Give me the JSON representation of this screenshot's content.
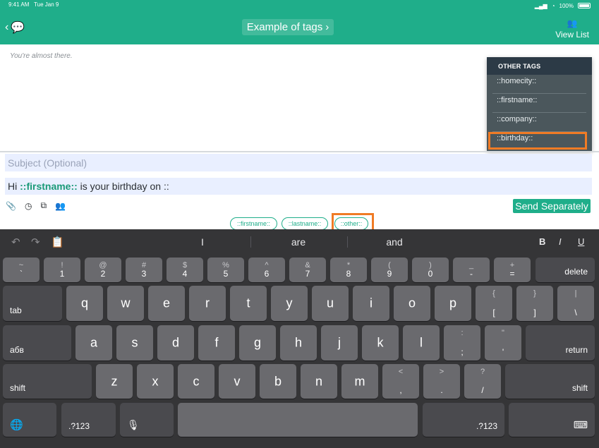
{
  "status": {
    "time": "9:41 AM",
    "date": "Tue Jan 9",
    "battery": "100%"
  },
  "nav": {
    "title": "Example of tags",
    "view_list": "View List"
  },
  "content": {
    "hint": "You're almost there."
  },
  "tags_panel": {
    "header": "OTHER TAGS",
    "items": [
      "::homecity::",
      "::firstname::",
      "::company::",
      "::birthday::"
    ]
  },
  "compose": {
    "subject_placeholder": "Subject (Optional)",
    "body_prefix": "Hi ",
    "body_tag": "::firstname::",
    "body_suffix": " is your birthday on ::",
    "send_label": "Send Separately"
  },
  "chips": [
    "::firstname::",
    "::lastname::",
    "::other::"
  ],
  "keyboard": {
    "suggestions": [
      "I",
      "are",
      "and"
    ],
    "format": [
      "B",
      "I",
      "U"
    ],
    "row1": [
      {
        "top": "~",
        "bot": "`"
      },
      {
        "top": "!",
        "bot": "1"
      },
      {
        "top": "@",
        "bot": "2"
      },
      {
        "top": "#",
        "bot": "3"
      },
      {
        "top": "$",
        "bot": "4"
      },
      {
        "top": "%",
        "bot": "5"
      },
      {
        "top": "^",
        "bot": "6"
      },
      {
        "top": "&",
        "bot": "7"
      },
      {
        "top": "*",
        "bot": "8"
      },
      {
        "top": "(",
        "bot": "9"
      },
      {
        "top": ")",
        "bot": "0"
      },
      {
        "top": "_",
        "bot": "-"
      },
      {
        "top": "+",
        "bot": "="
      }
    ],
    "delete": "delete",
    "tab": "tab",
    "row2": [
      "q",
      "w",
      "e",
      "r",
      "t",
      "y",
      "u",
      "i",
      "o",
      "p"
    ],
    "row2_extra": [
      {
        "top": "{",
        "bot": "["
      },
      {
        "top": "}",
        "bot": "]"
      },
      {
        "top": "|",
        "bot": "\\"
      }
    ],
    "caps": "абв",
    "row3": [
      "a",
      "s",
      "d",
      "f",
      "g",
      "h",
      "j",
      "k",
      "l"
    ],
    "row3_extra": [
      {
        "top": ":",
        "bot": ";"
      },
      {
        "top": "\"",
        "bot": "'"
      }
    ],
    "return": "return",
    "shift": "shift",
    "row4": [
      "z",
      "x",
      "c",
      "v",
      "b",
      "n",
      "m"
    ],
    "row4_extra": [
      {
        "top": "<",
        "bot": ","
      },
      {
        "top": ">",
        "bot": "."
      },
      {
        "top": "?",
        "bot": "/"
      }
    ],
    "numbers": ".?123"
  }
}
